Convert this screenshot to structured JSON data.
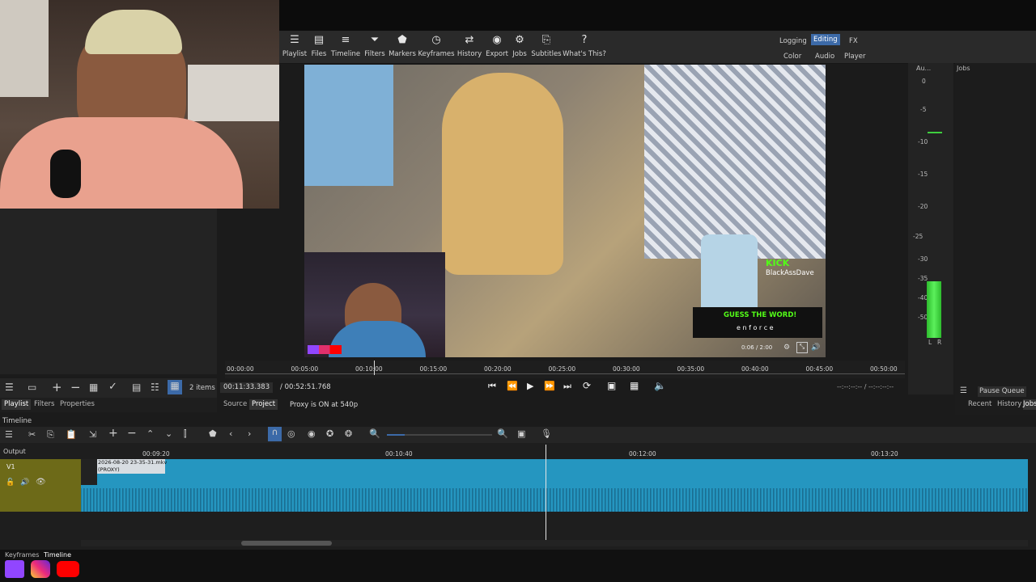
{
  "toolbar": {
    "items": [
      {
        "label": "Playlist",
        "icon": "playlist-icon"
      },
      {
        "label": "Files",
        "icon": "files-icon"
      },
      {
        "label": "Timeline",
        "icon": "timeline-icon"
      },
      {
        "label": "Filters",
        "icon": "filters-icon"
      },
      {
        "label": "Markers",
        "icon": "markers-icon"
      },
      {
        "label": "Keyframes",
        "icon": "keyframes-icon"
      },
      {
        "label": "History",
        "icon": "history-icon"
      },
      {
        "label": "Export",
        "icon": "export-icon"
      },
      {
        "label": "Jobs",
        "icon": "jobs-icon"
      },
      {
        "label": "Subtitles",
        "icon": "subtitles-icon"
      },
      {
        "label": "What's This?",
        "icon": "help-icon"
      }
    ],
    "layouts": {
      "logging": "Logging",
      "editing": "Editing",
      "fx": "FX",
      "color": "Color",
      "audio": "Audio",
      "player": "Player"
    }
  },
  "audio_meter": {
    "title": "Au...",
    "scale": [
      "0",
      "-5",
      "-10",
      "-15",
      "-20",
      "-25",
      "-30",
      "-35",
      "-40",
      "-50"
    ],
    "channels": [
      "L",
      "R"
    ],
    "level": 0.56
  },
  "jobs_panel": {
    "title": "Jobs",
    "pause_queue": "Pause Queue",
    "tabs": [
      "Recent",
      "History",
      "Jobs"
    ]
  },
  "overlay": {
    "platform": "KICK",
    "channel": "BlackAssDave",
    "game_title": "GUESS THE WORD!",
    "game_word": "e n f o r c e",
    "player_time": "0:06 / 2:00"
  },
  "ruler": {
    "ticks": [
      "00:00:00",
      "00:05:00",
      "00:10:00",
      "00:15:00",
      "00:20:00",
      "00:25:00",
      "00:30:00",
      "00:35:00",
      "00:40:00",
      "00:45:00",
      "00:50:00"
    ]
  },
  "player": {
    "current": "00:11:33.383",
    "total": "/ 00:52:51.768",
    "in_out": "--:--:--:-- / --:--:--:--"
  },
  "playlist": {
    "count": "2 items",
    "tabs": [
      "Playlist",
      "Filters",
      "Properties"
    ]
  },
  "source_tabs": {
    "source": "Source",
    "project": "Project",
    "proxy_note": "Proxy is ON at 540p"
  },
  "timeline": {
    "title": "Timeline",
    "output_label": "Output",
    "track": "V1",
    "ruler": [
      "00:09:20",
      "00:10:40",
      "00:12:00",
      "00:13:20"
    ],
    "clip_name": "2026-08-20 23-35-31.mkv",
    "clip_tag": "(PROXY)"
  },
  "bottom_tabs": [
    "Keyframes",
    "Timeline"
  ]
}
